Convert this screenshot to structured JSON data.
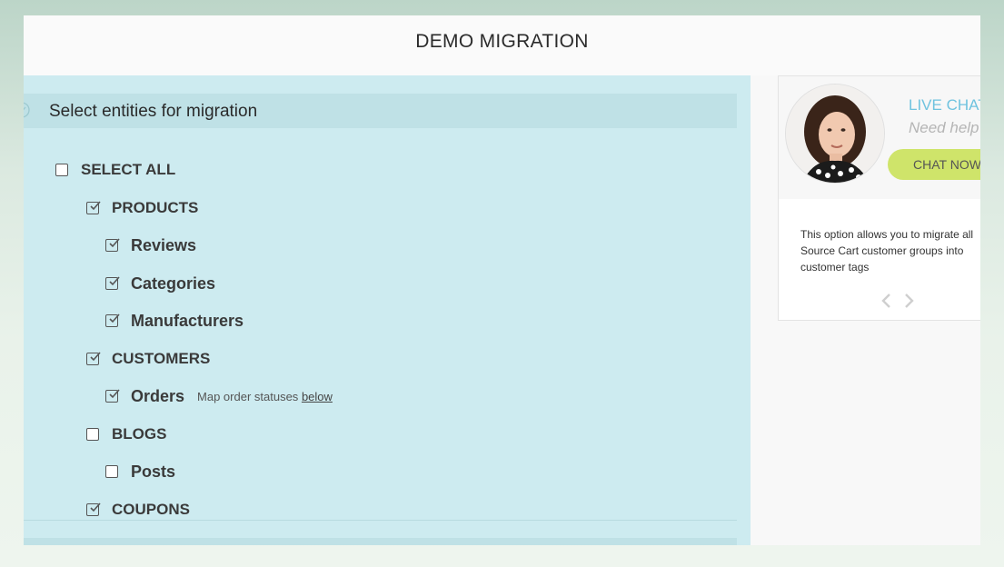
{
  "header": {
    "title": "DEMO MIGRATION"
  },
  "section": {
    "title": "Select entities for migration"
  },
  "entities": {
    "select_all": {
      "label": "SELECT ALL",
      "checked": false
    },
    "products": {
      "label": "PRODUCTS",
      "checked": true
    },
    "reviews": {
      "label": "Reviews",
      "checked": true
    },
    "categories": {
      "label": "Categories",
      "checked": true
    },
    "manufacturers": {
      "label": "Manufacturers",
      "checked": true
    },
    "customers": {
      "label": "CUSTOMERS",
      "checked": true
    },
    "orders": {
      "label": "Orders",
      "checked": true,
      "note_prefix": "Map order statuses",
      "note_link": "below"
    },
    "blogs": {
      "label": "BLOGS",
      "checked": false
    },
    "posts": {
      "label": "Posts",
      "checked": false
    },
    "coupons": {
      "label": "COUPONS",
      "checked": true
    }
  },
  "chat": {
    "title": "LIVE CHAT",
    "subtitle": "Need help?",
    "button_label": "CHAT NOW",
    "info": "This option allows you to migrate all Source Cart customer groups into customer tags"
  },
  "colors": {
    "panel_bg": "#cdebf0",
    "accent_blue": "#6fc3df",
    "chat_button": "#cfe46a"
  }
}
